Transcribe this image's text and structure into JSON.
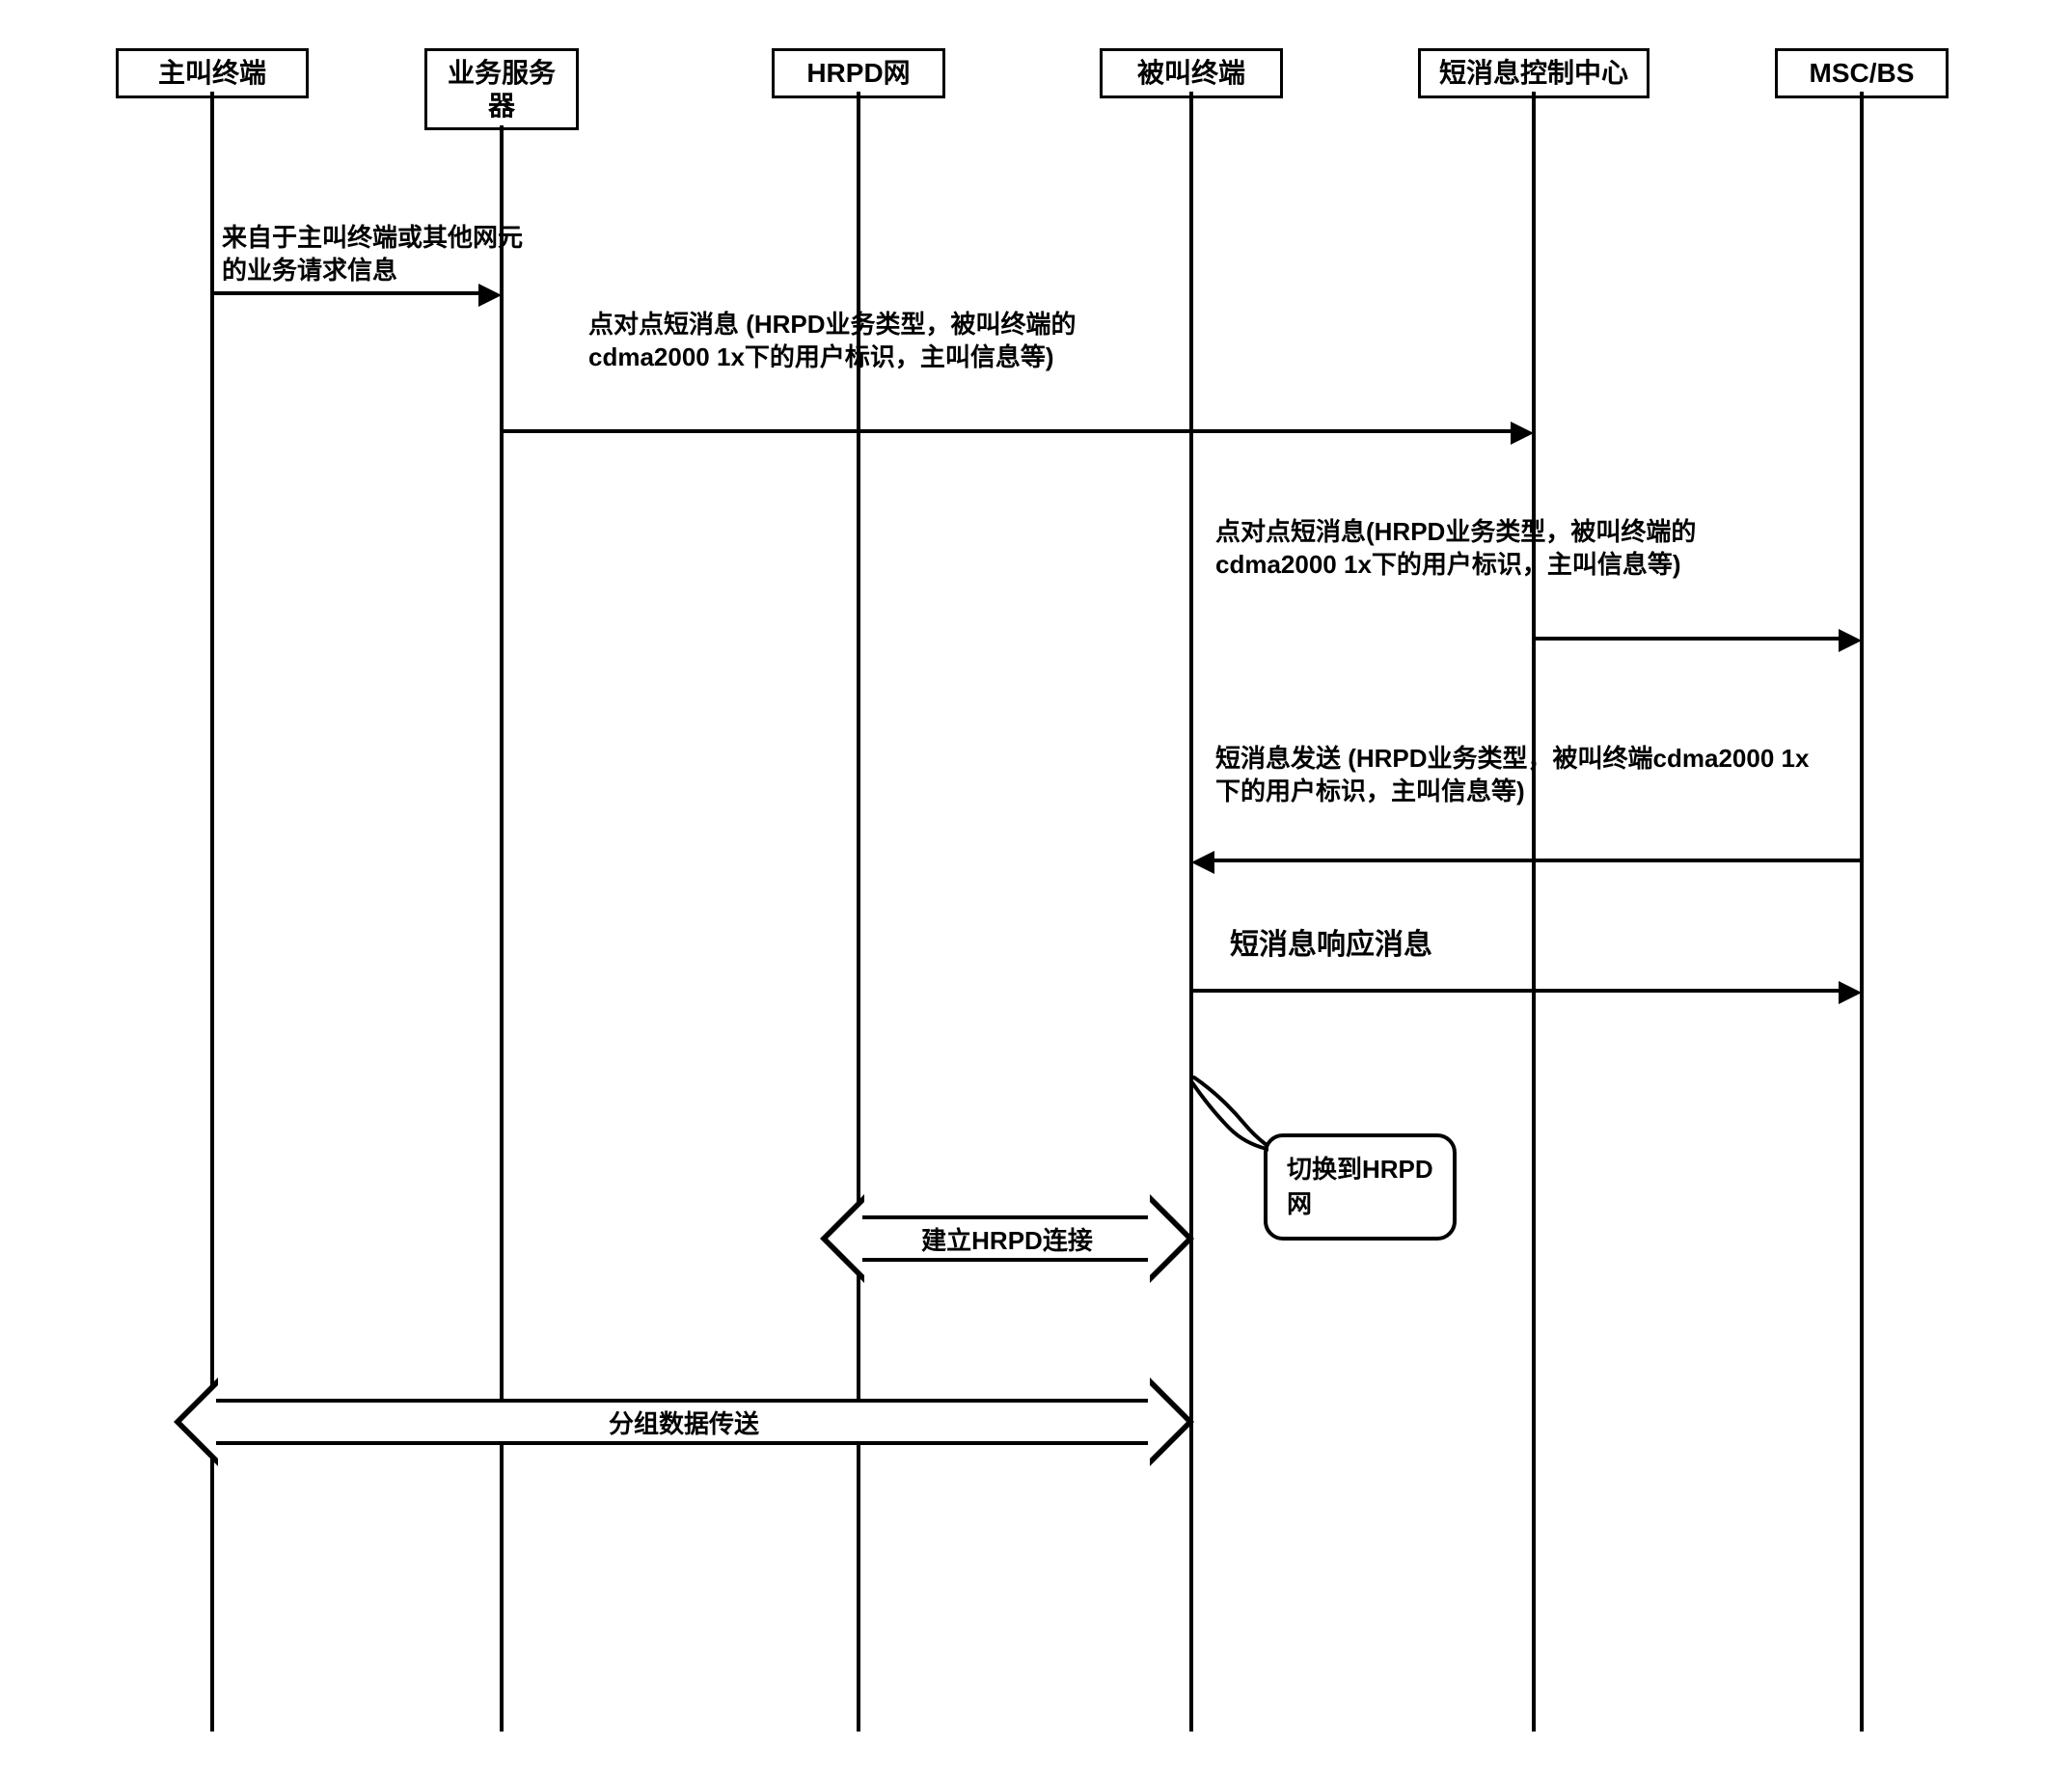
{
  "participants": {
    "p1": "主叫终端",
    "p2": "业务服务器",
    "p3": "HRPD网",
    "p4": "被叫终端",
    "p5": "短消息控制中心",
    "p6": "MSC/BS"
  },
  "messages": {
    "m1": "来自于主叫终端或其他网元的业务请求信息",
    "m2": "点对点短消息 (HRPD业务类型，被叫终端的cdma2000 1x下的用户标识，主叫信息等)",
    "m3": "点对点短消息(HRPD业务类型，被叫终端的cdma2000 1x下的用户标识，主叫信息等)",
    "m4": "短消息发送 (HRPD业务类型，被叫终端cdma2000 1x下的用户标识，主叫信息等)",
    "m5": "短消息响应消息",
    "m6": "建立HRPD连接",
    "m7": "分组数据传送"
  },
  "callout": {
    "c1": "切换到HRPD 网"
  },
  "chart_data": {
    "type": "sequence_diagram",
    "participants": [
      "主叫终端",
      "业务服务器",
      "HRPD网",
      "被叫终端",
      "短消息控制中心",
      "MSC/BS"
    ],
    "interactions": [
      {
        "from": "主叫终端",
        "to": "业务服务器",
        "label": "来自于主叫终端或其他网元的业务请求信息",
        "direction": "right"
      },
      {
        "from": "业务服务器",
        "to": "短消息控制中心",
        "label": "点对点短消息 (HRPD业务类型，被叫终端的cdma2000 1x下的用户标识，主叫信息等)",
        "direction": "right"
      },
      {
        "from": "短消息控制中心",
        "to": "MSC/BS",
        "label": "点对点短消息(HRPD业务类型，被叫终端的cdma2000 1x下的用户标识，主叫信息等)",
        "direction": "right"
      },
      {
        "from": "MSC/BS",
        "to": "被叫终端",
        "label": "短消息发送 (HRPD业务类型，被叫终端cdma2000 1x下的用户标识，主叫信息等)",
        "direction": "left"
      },
      {
        "from": "被叫终端",
        "to": "MSC/BS",
        "label": "短消息响应消息",
        "direction": "right"
      },
      {
        "note_on": "被叫终端",
        "label": "切换到HRPD 网"
      },
      {
        "from": "HRPD网",
        "to": "被叫终端",
        "label": "建立HRPD连接",
        "direction": "bidirectional"
      },
      {
        "from": "主叫终端",
        "to": "被叫终端",
        "label": "分组数据传送",
        "direction": "bidirectional"
      }
    ]
  }
}
